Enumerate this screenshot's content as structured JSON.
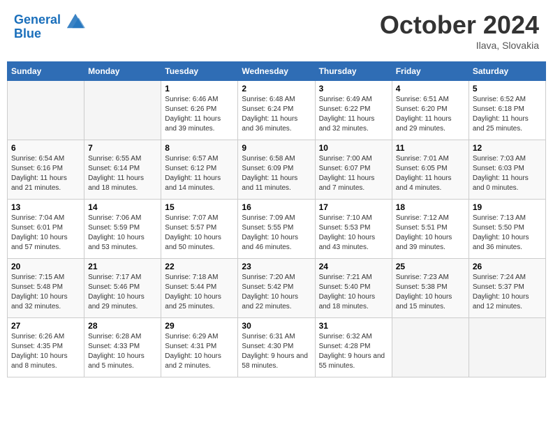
{
  "header": {
    "logo_line1": "General",
    "logo_line2": "Blue",
    "month": "October 2024",
    "location": "Ilava, Slovakia"
  },
  "days_of_week": [
    "Sunday",
    "Monday",
    "Tuesday",
    "Wednesday",
    "Thursday",
    "Friday",
    "Saturday"
  ],
  "weeks": [
    [
      {
        "day": "",
        "info": ""
      },
      {
        "day": "",
        "info": ""
      },
      {
        "day": "1",
        "info": "Sunrise: 6:46 AM\nSunset: 6:26 PM\nDaylight: 11 hours and 39 minutes."
      },
      {
        "day": "2",
        "info": "Sunrise: 6:48 AM\nSunset: 6:24 PM\nDaylight: 11 hours and 36 minutes."
      },
      {
        "day": "3",
        "info": "Sunrise: 6:49 AM\nSunset: 6:22 PM\nDaylight: 11 hours and 32 minutes."
      },
      {
        "day": "4",
        "info": "Sunrise: 6:51 AM\nSunset: 6:20 PM\nDaylight: 11 hours and 29 minutes."
      },
      {
        "day": "5",
        "info": "Sunrise: 6:52 AM\nSunset: 6:18 PM\nDaylight: 11 hours and 25 minutes."
      }
    ],
    [
      {
        "day": "6",
        "info": "Sunrise: 6:54 AM\nSunset: 6:16 PM\nDaylight: 11 hours and 21 minutes."
      },
      {
        "day": "7",
        "info": "Sunrise: 6:55 AM\nSunset: 6:14 PM\nDaylight: 11 hours and 18 minutes."
      },
      {
        "day": "8",
        "info": "Sunrise: 6:57 AM\nSunset: 6:12 PM\nDaylight: 11 hours and 14 minutes."
      },
      {
        "day": "9",
        "info": "Sunrise: 6:58 AM\nSunset: 6:09 PM\nDaylight: 11 hours and 11 minutes."
      },
      {
        "day": "10",
        "info": "Sunrise: 7:00 AM\nSunset: 6:07 PM\nDaylight: 11 hours and 7 minutes."
      },
      {
        "day": "11",
        "info": "Sunrise: 7:01 AM\nSunset: 6:05 PM\nDaylight: 11 hours and 4 minutes."
      },
      {
        "day": "12",
        "info": "Sunrise: 7:03 AM\nSunset: 6:03 PM\nDaylight: 11 hours and 0 minutes."
      }
    ],
    [
      {
        "day": "13",
        "info": "Sunrise: 7:04 AM\nSunset: 6:01 PM\nDaylight: 10 hours and 57 minutes."
      },
      {
        "day": "14",
        "info": "Sunrise: 7:06 AM\nSunset: 5:59 PM\nDaylight: 10 hours and 53 minutes."
      },
      {
        "day": "15",
        "info": "Sunrise: 7:07 AM\nSunset: 5:57 PM\nDaylight: 10 hours and 50 minutes."
      },
      {
        "day": "16",
        "info": "Sunrise: 7:09 AM\nSunset: 5:55 PM\nDaylight: 10 hours and 46 minutes."
      },
      {
        "day": "17",
        "info": "Sunrise: 7:10 AM\nSunset: 5:53 PM\nDaylight: 10 hours and 43 minutes."
      },
      {
        "day": "18",
        "info": "Sunrise: 7:12 AM\nSunset: 5:51 PM\nDaylight: 10 hours and 39 minutes."
      },
      {
        "day": "19",
        "info": "Sunrise: 7:13 AM\nSunset: 5:50 PM\nDaylight: 10 hours and 36 minutes."
      }
    ],
    [
      {
        "day": "20",
        "info": "Sunrise: 7:15 AM\nSunset: 5:48 PM\nDaylight: 10 hours and 32 minutes."
      },
      {
        "day": "21",
        "info": "Sunrise: 7:17 AM\nSunset: 5:46 PM\nDaylight: 10 hours and 29 minutes."
      },
      {
        "day": "22",
        "info": "Sunrise: 7:18 AM\nSunset: 5:44 PM\nDaylight: 10 hours and 25 minutes."
      },
      {
        "day": "23",
        "info": "Sunrise: 7:20 AM\nSunset: 5:42 PM\nDaylight: 10 hours and 22 minutes."
      },
      {
        "day": "24",
        "info": "Sunrise: 7:21 AM\nSunset: 5:40 PM\nDaylight: 10 hours and 18 minutes."
      },
      {
        "day": "25",
        "info": "Sunrise: 7:23 AM\nSunset: 5:38 PM\nDaylight: 10 hours and 15 minutes."
      },
      {
        "day": "26",
        "info": "Sunrise: 7:24 AM\nSunset: 5:37 PM\nDaylight: 10 hours and 12 minutes."
      }
    ],
    [
      {
        "day": "27",
        "info": "Sunrise: 6:26 AM\nSunset: 4:35 PM\nDaylight: 10 hours and 8 minutes."
      },
      {
        "day": "28",
        "info": "Sunrise: 6:28 AM\nSunset: 4:33 PM\nDaylight: 10 hours and 5 minutes."
      },
      {
        "day": "29",
        "info": "Sunrise: 6:29 AM\nSunset: 4:31 PM\nDaylight: 10 hours and 2 minutes."
      },
      {
        "day": "30",
        "info": "Sunrise: 6:31 AM\nSunset: 4:30 PM\nDaylight: 9 hours and 58 minutes."
      },
      {
        "day": "31",
        "info": "Sunrise: 6:32 AM\nSunset: 4:28 PM\nDaylight: 9 hours and 55 minutes."
      },
      {
        "day": "",
        "info": ""
      },
      {
        "day": "",
        "info": ""
      }
    ]
  ]
}
